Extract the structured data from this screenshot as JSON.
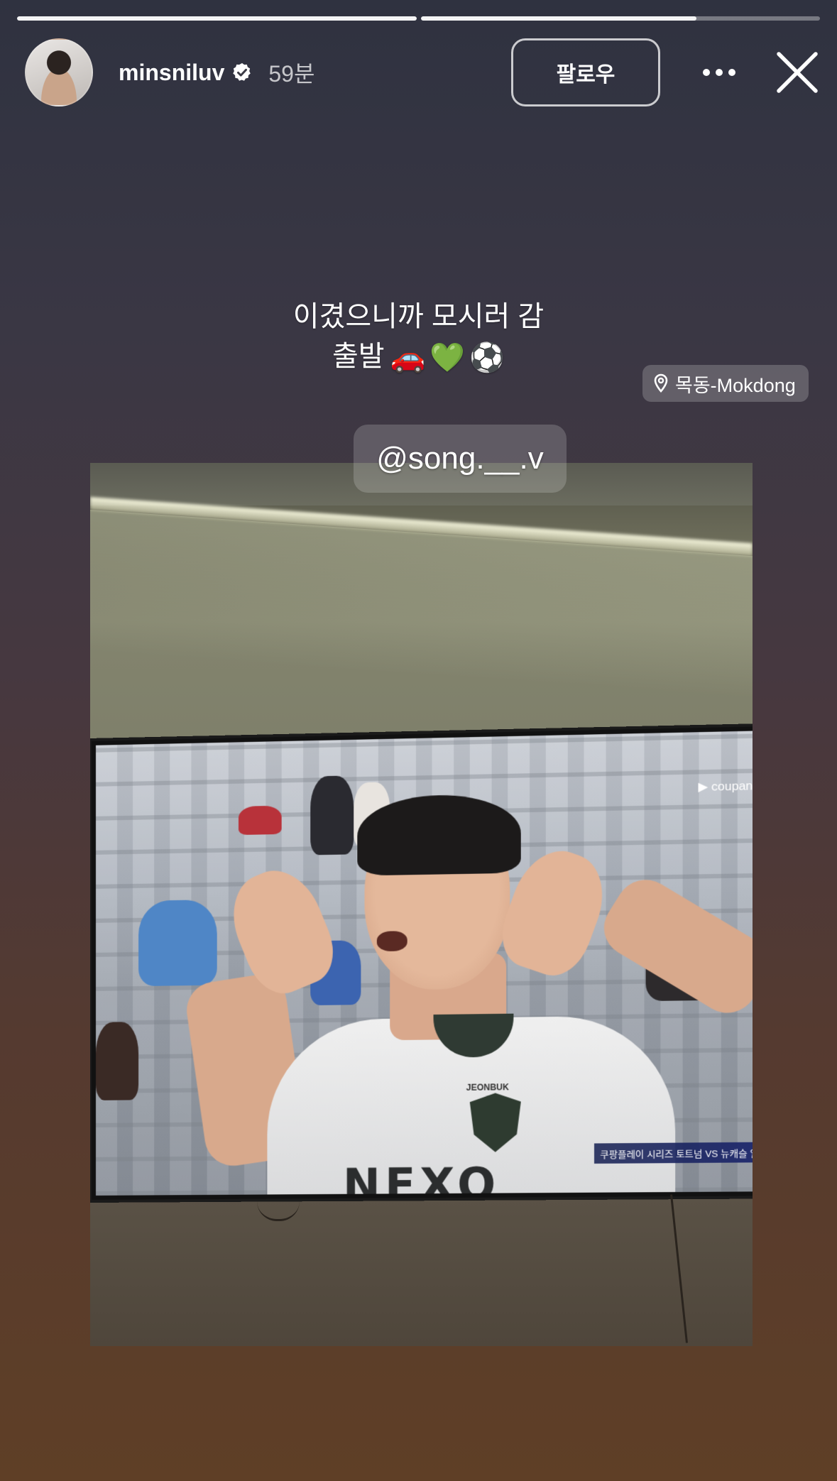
{
  "progress": [
    {
      "fill": 1.0
    },
    {
      "fill": 0.69
    }
  ],
  "header": {
    "username": "minsniluv",
    "verified_icon": "verified-badge-icon",
    "time": "59분",
    "follow_label": "팔로우",
    "more_icon": "more-dots-icon",
    "close_icon": "close-icon"
  },
  "story": {
    "caption_line1": "이겼으니까 모시러 감",
    "caption_line2": "출발",
    "caption_emojis": [
      "🚗",
      "💚",
      "⚽"
    ],
    "location": "목동-Mokdong",
    "mention": "@song.__.v",
    "tv": {
      "broadcaster": "coupang",
      "ticker": "쿠팡플레이 시리즈 토트넘 VS 뉴캐슬 일반 예매 오픈",
      "jersey_team": "JEONBUK",
      "jersey_sponsor": "NEXO"
    }
  },
  "colors": {
    "bg_top": "#2f3240",
    "bg_bottom": "#5f3f26",
    "progress_track": "rgba(255,255,255,0.35)",
    "progress_fill": "#ffffff"
  }
}
